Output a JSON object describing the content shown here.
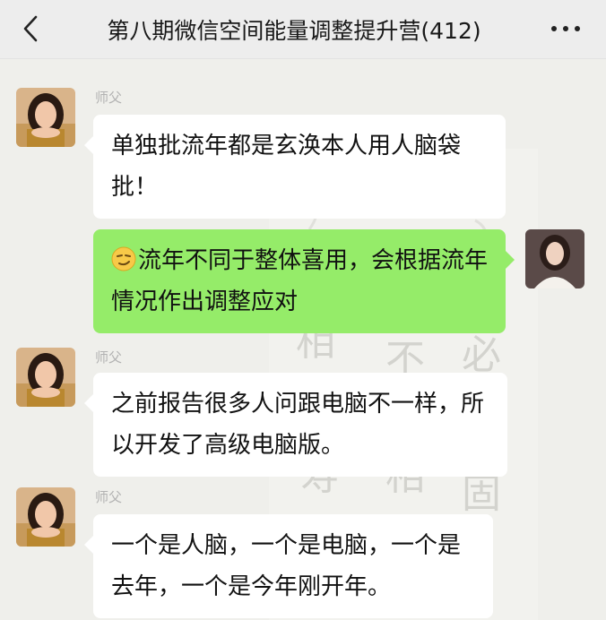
{
  "header": {
    "title": "第八期微信空间能量调整提升营(412)",
    "back_icon": "chevron-left-icon",
    "more_icon": "more-dots-icon"
  },
  "messages": [
    {
      "direction": "incoming",
      "sender": "师父",
      "text": "单独批流年都是玄涣本人用人脑袋批！"
    },
    {
      "direction": "outgoing",
      "emoji": "smirk-emoji",
      "text": "流年不同于整体喜用，会根据流年情况作出调整应对"
    },
    {
      "direction": "incoming",
      "sender": "师父",
      "text": "之前报告很多人问跟电脑不一样，所以开发了高级电脑版。"
    },
    {
      "direction": "incoming",
      "sender": "师父",
      "text": "一个是人脑，一个是电脑，一个是去年，一个是今年刚开年。"
    }
  ],
  "background_art": [
    "相",
    "不",
    "必",
    "相",
    "固",
    "寿"
  ],
  "colors": {
    "header_bg": "#ededed",
    "chat_bg": "#efefeb",
    "incoming_bubble": "#ffffff",
    "outgoing_bubble": "#95ec69",
    "sender_name": "#b2b2b2"
  }
}
